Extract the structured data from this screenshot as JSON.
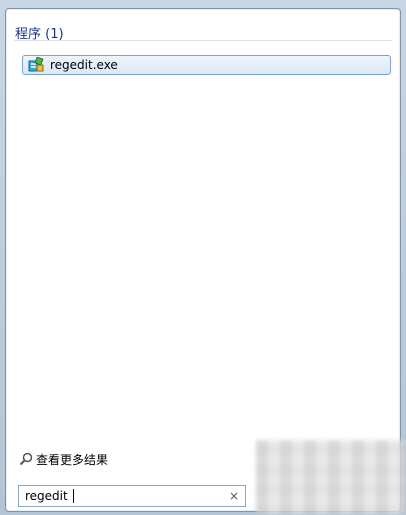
{
  "results": {
    "header": "程序 (1)",
    "items": [
      {
        "label": "regedit.exe",
        "icon": "registry-editor-icon"
      }
    ]
  },
  "see_more": {
    "label": "查看更多结果",
    "icon": "search-icon"
  },
  "search": {
    "value": "regedit",
    "clear_icon": "clear-icon",
    "clear_glyph": "×"
  },
  "colors": {
    "header_text": "#1e3287",
    "highlight_border": "#7da2ce",
    "highlight_fill": "#dbe8f7"
  }
}
